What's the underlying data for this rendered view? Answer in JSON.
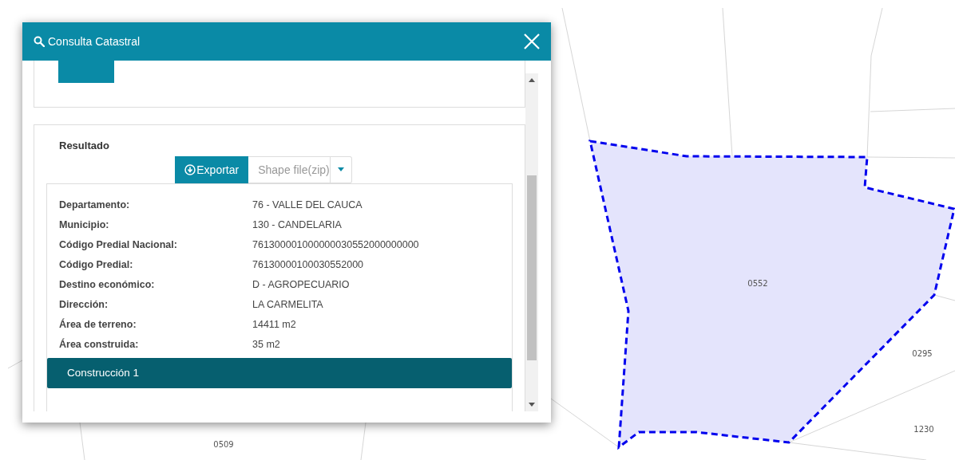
{
  "dialog": {
    "title": "Consulta Catastral",
    "result_section": {
      "title": "Resultado",
      "export_button": "Exportar",
      "format_select": {
        "value": "Shape file(zip)"
      },
      "fields": [
        {
          "label": "Departamento:",
          "value": "76 - VALLE DEL CAUCA"
        },
        {
          "label": "Municipio:",
          "value": "130 - CANDELARIA"
        },
        {
          "label": "Código Predial Nacional:",
          "value": "761300001000000030552000000000"
        },
        {
          "label": "Código Predial:",
          "value": "76130000100030552000"
        },
        {
          "label": "Destino económico:",
          "value": "D - AGROPECUARIO"
        },
        {
          "label": "Dirección:",
          "value": "LA CARMELITA"
        },
        {
          "label": "Área de terreno:",
          "value": "14411 m2"
        },
        {
          "label": "Área construida:",
          "value": "35 m2"
        }
      ],
      "construction_header": "Construcción 1"
    }
  },
  "map": {
    "parcel_labels": [
      "0552",
      "0295",
      "1230",
      "0509"
    ]
  }
}
